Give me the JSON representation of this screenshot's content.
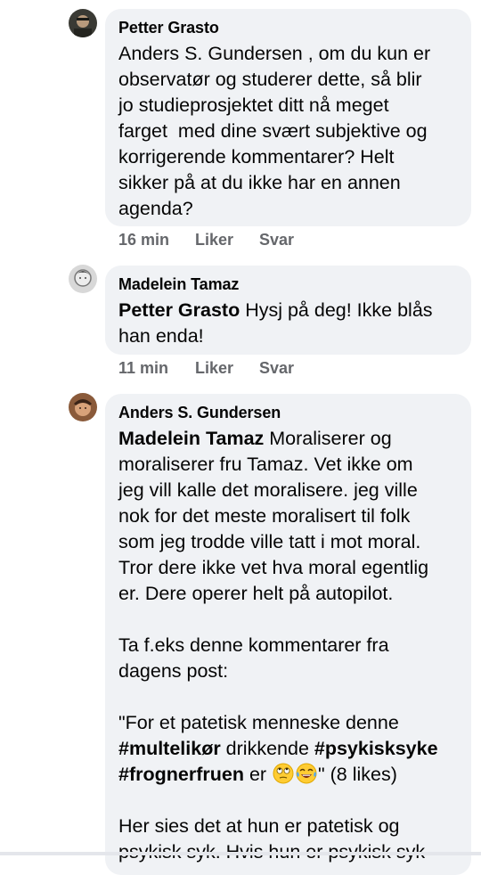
{
  "comments": [
    {
      "author": "Petter Grasto",
      "lines": [
        "Anders S. Gundersen , om du kun er",
        "observatør og studerer dette, så blir",
        "jo studieprosjektet ditt nå meget",
        "farget  med dine svært subjektive og",
        "korrigerende kommentarer? Helt",
        "sikker på at du ikke har en annen",
        "agenda?"
      ],
      "time": "16 min",
      "like": "Liker",
      "reply": "Svar"
    },
    {
      "author": "Madelein Tamaz",
      "mention": "Petter Grasto",
      "lines": [
        " Hysj på deg! Ikke blås",
        "han enda!"
      ],
      "time": "11 min",
      "like": "Liker",
      "reply": "Svar"
    },
    {
      "author": "Anders S. Gundersen",
      "mention": "Madelein Tamaz",
      "lines": [
        " Moraliserer og",
        "moraliserer fru Tamaz. Vet ikke om",
        "jeg vill kalle det moralisere. jeg ville",
        "nok for det meste moralisert til folk",
        "som jeg trodde ville tatt i mot moral.",
        "Tror dere ikke vet hva moral egentlig",
        "er. Dere operer helt på autopilot.",
        "",
        "Ta f.eks denne kommentarer fra",
        "dagens post:",
        "",
        "\"For et patetisk menneske denne"
      ],
      "quote": {
        "tag1": "#multelikør",
        "mid1": " drikkende ",
        "tag2": "#psykisksyke",
        "tag3": "#frognerfruen",
        "mid2": " er ",
        "tail": "\" (8 likes)"
      },
      "after": [
        "",
        "Her sies det at hun er patetisk og",
        "psykisk syk. Hvis hun er psykisk syk"
      ]
    }
  ],
  "colors": {
    "bubble": "#f0f2f5",
    "meta": "#65676b",
    "text": "#050505"
  },
  "icons": [
    "rolling-eyes-emoji",
    "crying-laughing-emoji"
  ]
}
